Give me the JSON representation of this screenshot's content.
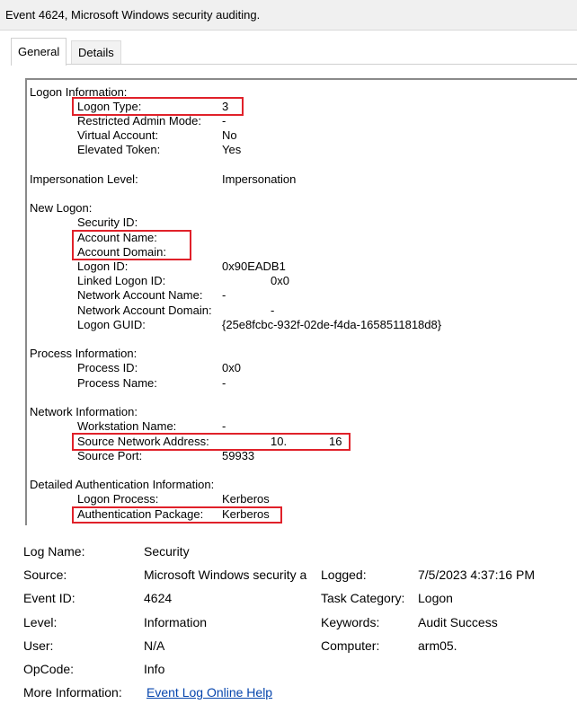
{
  "window": {
    "title": "Event 4624, Microsoft Windows security auditing."
  },
  "tabs": [
    {
      "label": "General",
      "active": true
    },
    {
      "label": "Details",
      "active": false
    }
  ],
  "description": {
    "logon_information": {
      "heading": "Logon Information:",
      "logon_type_label": "Logon Type:",
      "logon_type_value": "3",
      "restricted_admin_label": "Restricted Admin Mode:",
      "restricted_admin_value": "-",
      "virtual_account_label": "Virtual Account:",
      "virtual_account_value": "No",
      "elevated_token_label": "Elevated Token:",
      "elevated_token_value": "Yes"
    },
    "impersonation": {
      "label": "Impersonation Level:",
      "value": "Impersonation"
    },
    "new_logon": {
      "heading": "New Logon:",
      "security_id_label": "Security ID:",
      "account_name_label": "Account Name:",
      "account_domain_label": "Account Domain:",
      "logon_id_label": "Logon ID:",
      "logon_id_value": "0x90EADB1",
      "linked_logon_id_label": "Linked Logon ID:",
      "linked_logon_id_value": "0x0",
      "network_account_name_label": "Network Account Name:",
      "network_account_name_value": "-",
      "network_account_domain_label": "Network Account Domain:",
      "network_account_domain_value": "-",
      "logon_guid_label": "Logon GUID:",
      "logon_guid_value": "{25e8fcbc-932f-02de-f4da-1658511818d8}"
    },
    "process_information": {
      "heading": "Process Information:",
      "process_id_label": "Process ID:",
      "process_id_value": "0x0",
      "process_name_label": "Process Name:",
      "process_name_value": "-"
    },
    "network_information": {
      "heading": "Network Information:",
      "workstation_name_label": "Workstation Name:",
      "workstation_name_value": "-",
      "source_network_address_label": "Source Network Address:",
      "source_network_address_value_a": "10.",
      "source_network_address_value_b": "16",
      "source_port_label": "Source Port:",
      "source_port_value": "59933"
    },
    "detailed_auth": {
      "heading": "Detailed Authentication Information:",
      "logon_process_label": "Logon Process:",
      "logon_process_value": "Kerberos",
      "auth_package_label": "Authentication Package:",
      "auth_package_value": "Kerberos"
    }
  },
  "highlight_color": "#e0212a",
  "meta": {
    "log_name_label": "Log Name:",
    "log_name_value": "Security",
    "source_label": "Source:",
    "source_value": "Microsoft Windows security a",
    "logged_label": "Logged:",
    "logged_value": "7/5/2023 4:37:16 PM",
    "event_id_label": "Event ID:",
    "event_id_value": "4624",
    "task_category_label": "Task Category:",
    "task_category_value": "Logon",
    "level_label": "Level:",
    "level_value": "Information",
    "keywords_label": "Keywords:",
    "keywords_value": "Audit Success",
    "user_label": "User:",
    "user_value": "N/A",
    "computer_label": "Computer:",
    "computer_value": "arm05.",
    "opcode_label": "OpCode:",
    "opcode_value": "Info",
    "more_info_label": "More Information:",
    "more_info_link": "Event Log Online Help"
  }
}
